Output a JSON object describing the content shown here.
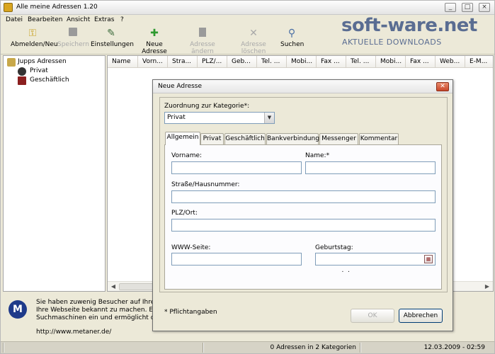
{
  "window": {
    "title": "Alle meine Adressen 1.20"
  },
  "menu": [
    "Datei",
    "Bearbeiten",
    "Ansicht",
    "Extras",
    "?"
  ],
  "toolbar": [
    {
      "label": "Abmelden/Neu",
      "icon": "key-icon",
      "enabled": true
    },
    {
      "label": "Speichern",
      "icon": "save-icon",
      "enabled": false
    },
    {
      "label": "Einstellungen",
      "icon": "settings-icon",
      "enabled": true
    },
    {
      "label": "Neue Adresse",
      "icon": "add-icon",
      "enabled": true
    },
    {
      "label": "Adresse ändern",
      "icon": "edit-icon",
      "enabled": false
    },
    {
      "label": "Adresse löschen",
      "icon": "delete-icon",
      "enabled": false
    },
    {
      "label": "Suchen",
      "icon": "search-icon",
      "enabled": true
    }
  ],
  "branding": {
    "main": "soft-ware.net",
    "sub": "AKTUELLE DOWNLOADS"
  },
  "tree": {
    "root": "Jupps Adressen",
    "children": [
      "Privat",
      "Geschäftlich"
    ]
  },
  "list": {
    "columns": [
      "Name",
      "Vorn...",
      "Stra...",
      "PLZ/...",
      "Geb...",
      "Tel. ...",
      "Mobi...",
      "Fax ...",
      "Tel. ...",
      "Mobi...",
      "Fax ...",
      "Web...",
      "E-M..."
    ]
  },
  "info": {
    "line1": "Sie haben zuwenig Besucher auf Ihrer W",
    "line2": "Ihre Webseite bekannt zu machen. Es tr",
    "line3": "Suchmaschinen ein und ermöglicht die ei",
    "url": "http://www.metaner.de/"
  },
  "status": {
    "count": "0 Adressen in 2 Kategorien",
    "datetime": "12.03.2009 - 02:59"
  },
  "dialog": {
    "title": "Neue Adresse",
    "category_label": "Zuordnung zur Kategorie*:",
    "category_value": "Privat",
    "tabs": [
      "Allgemein",
      "Privat",
      "Geschäftlich",
      "Bankverbindung",
      "Messenger",
      "Kommentar"
    ],
    "active_tab": "Allgemein",
    "fields": {
      "vorname": {
        "label": "Vorname:",
        "value": ""
      },
      "name": {
        "label": "Name:*",
        "value": ""
      },
      "strasse": {
        "label": "Straße/Hausnummer:",
        "value": ""
      },
      "plz_ort": {
        "label": "PLZ/Ort:",
        "value": ""
      },
      "www": {
        "label": "WWW-Seite:",
        "value": ""
      },
      "geburtstag": {
        "label": "Geburtstag:",
        "value": " .  ."
      }
    },
    "required_note": "* Pflichtangaben",
    "ok_label": "OK",
    "cancel_label": "Abbrechen"
  }
}
